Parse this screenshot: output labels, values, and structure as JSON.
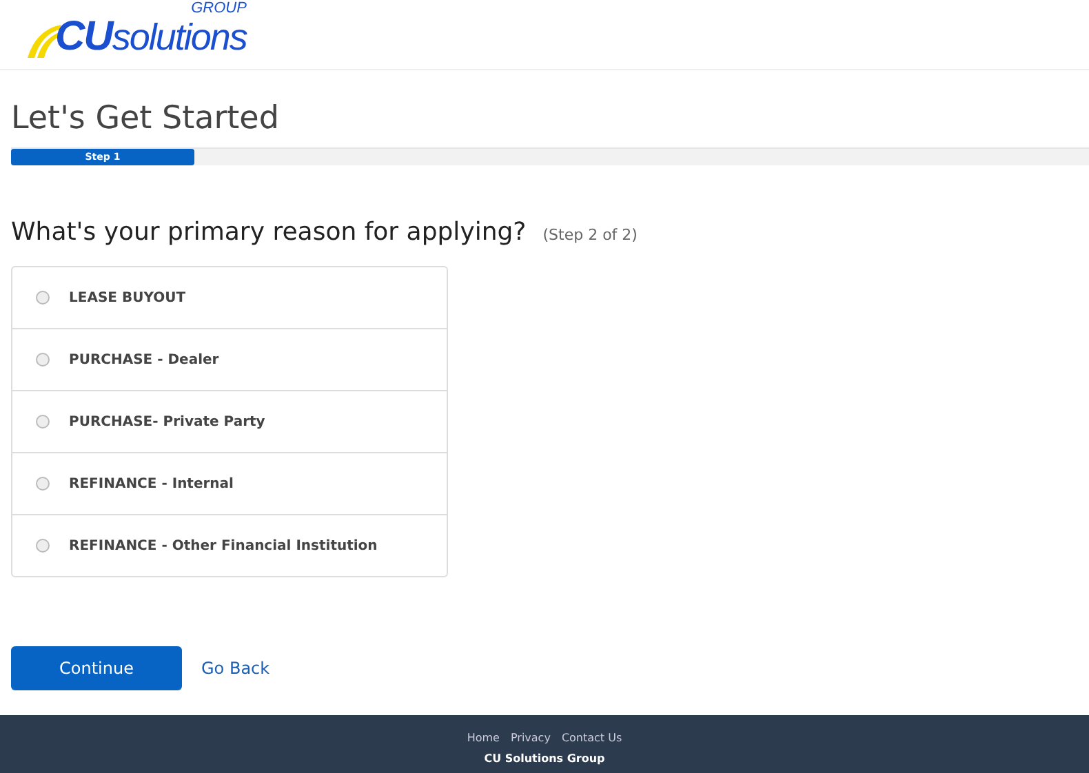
{
  "logo": {
    "brand_bold": "CU",
    "brand": "solutions",
    "tagline": "GROUP"
  },
  "page_title": "Let's Get Started",
  "progress": {
    "label": "Step 1",
    "level": 0.17
  },
  "question": {
    "text": "What's your primary reason for applying?",
    "step": "(Step 2 of 2)"
  },
  "options": [
    {
      "label": "LEASE BUYOUT",
      "selected": false
    },
    {
      "label": "PURCHASE - Dealer",
      "selected": false
    },
    {
      "label": "PURCHASE- Private Party",
      "selected": false
    },
    {
      "label": "REFINANCE - Internal",
      "selected": false
    },
    {
      "label": "REFINANCE - Other Financial Institution",
      "selected": false
    }
  ],
  "buttons": {
    "continue": "Continue",
    "back": "Go Back"
  },
  "footer": {
    "links": [
      "Home",
      "Privacy",
      "Contact Us"
    ],
    "company": "CU Solutions Group"
  }
}
